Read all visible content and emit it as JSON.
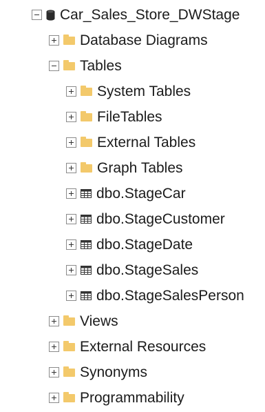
{
  "tree": {
    "root": {
      "label": "Car_Sales_Store_DWStage",
      "expander": "minus",
      "icon": "database-icon"
    },
    "items": [
      {
        "label": "Database Diagrams",
        "expander": "plus",
        "icon": "folder-icon"
      },
      {
        "label": "Tables",
        "expander": "minus",
        "icon": "folder-icon"
      },
      {
        "label": "System Tables",
        "expander": "plus",
        "icon": "folder-icon"
      },
      {
        "label": "FileTables",
        "expander": "plus",
        "icon": "folder-icon"
      },
      {
        "label": "External Tables",
        "expander": "plus",
        "icon": "folder-icon"
      },
      {
        "label": "Graph Tables",
        "expander": "plus",
        "icon": "folder-icon"
      },
      {
        "label": "dbo.StageCar",
        "expander": "plus",
        "icon": "table-icon"
      },
      {
        "label": "dbo.StageCustomer",
        "expander": "plus",
        "icon": "table-icon"
      },
      {
        "label": "dbo.StageDate",
        "expander": "plus",
        "icon": "table-icon"
      },
      {
        "label": "dbo.StageSales",
        "expander": "plus",
        "icon": "table-icon"
      },
      {
        "label": "dbo.StageSalesPerson",
        "expander": "plus",
        "icon": "table-icon"
      },
      {
        "label": "Views",
        "expander": "plus",
        "icon": "folder-icon"
      },
      {
        "label": "External Resources",
        "expander": "plus",
        "icon": "folder-icon"
      },
      {
        "label": "Synonyms",
        "expander": "plus",
        "icon": "folder-icon"
      },
      {
        "label": "Programmability",
        "expander": "plus",
        "icon": "folder-icon"
      }
    ]
  }
}
